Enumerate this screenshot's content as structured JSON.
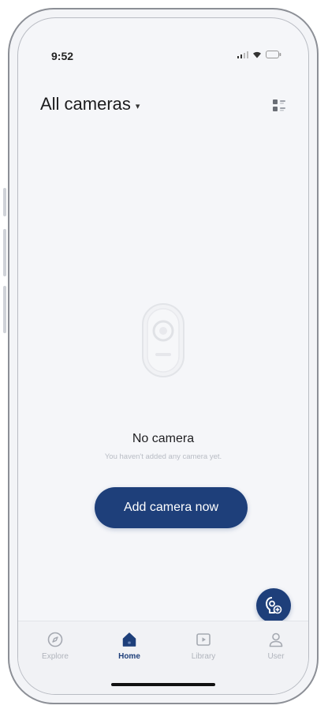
{
  "status_bar": {
    "time": "9:52"
  },
  "header": {
    "title": "All cameras",
    "caret": "▾"
  },
  "empty_state": {
    "title": "No camera",
    "subtitle": "You haven't added any camera yet."
  },
  "actions": {
    "add_camera_label": "Add camera now"
  },
  "tabs": [
    {
      "label": "Explore",
      "icon": "compass-icon",
      "active": false
    },
    {
      "label": "Home",
      "icon": "home-icon",
      "active": true
    },
    {
      "label": "Library",
      "icon": "play-library-icon",
      "active": false
    },
    {
      "label": "User",
      "icon": "user-icon",
      "active": false
    }
  ],
  "colors": {
    "accent": "#1e3f7a",
    "background": "#f5f6f9",
    "tab_inactive": "#b0b4bc"
  }
}
